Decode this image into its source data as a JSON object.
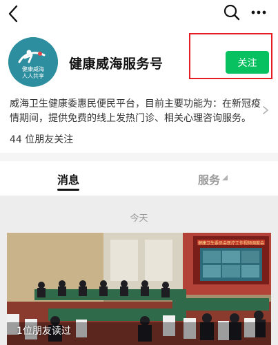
{
  "topbar": {
    "icons": [
      "back-icon",
      "search-icon",
      "more-icon"
    ]
  },
  "profile": {
    "avatar_text_line1": "健康威海",
    "avatar_text_line2": "人人共享",
    "name": "健康威海服务号",
    "follow_label": "关注"
  },
  "description": "威海卫生健康委惠民便民平台，目前主要功能为：在新冠疫情期间，提供免费的线上发热门诊、相关心理咨询服务。",
  "followers": "44 位朋友关注",
  "tabs": {
    "messages": "消息",
    "services": "服务"
  },
  "feed": {
    "date": "今天",
    "article": {
      "read_count": "1位朋友读过",
      "banner_text": "健康卫生委员会医疗工作视频调度会"
    }
  },
  "colors": {
    "follow_green": "#07c160",
    "highlight_red": "#e51c23"
  }
}
